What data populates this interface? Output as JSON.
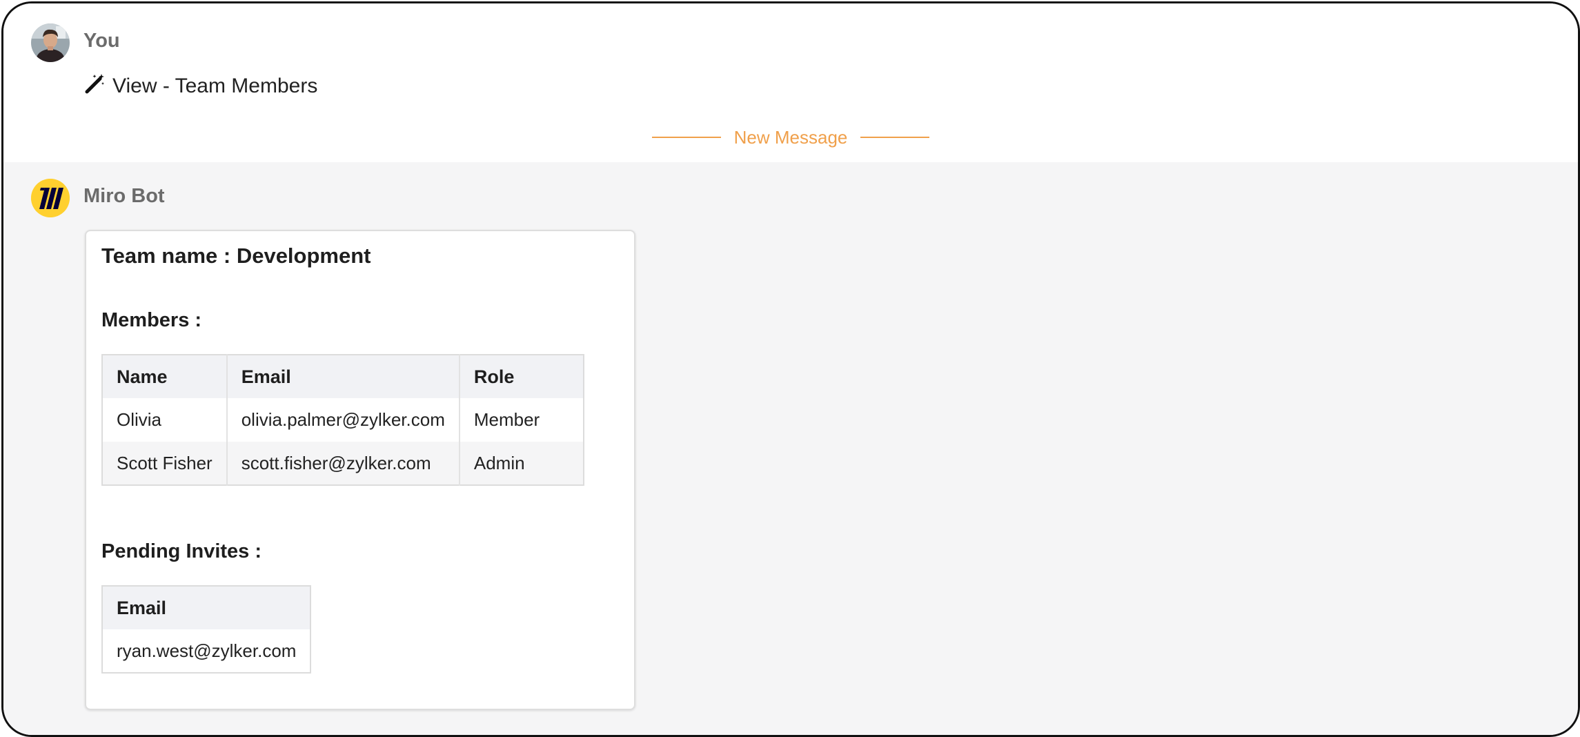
{
  "user_message": {
    "sender": "You",
    "command_icon": "magic-wand-icon",
    "command_text": "View - Team Members"
  },
  "divider": {
    "label": "New Message",
    "color": "#f0a04b"
  },
  "bot_message": {
    "sender": "Miro Bot",
    "avatar_icon": "miro-logo-icon",
    "avatar_color": "#ffd02f",
    "card": {
      "title": "Team name : Development",
      "members_heading": "Members :",
      "members_table": {
        "columns": [
          "Name",
          "Email",
          "Role"
        ],
        "rows": [
          [
            "Olivia",
            "olivia.palmer@zylker.com",
            "Member"
          ],
          [
            "Scott Fisher",
            "scott.fisher@zylker.com",
            "Admin"
          ]
        ]
      },
      "pending_heading": "Pending Invites :",
      "pending_table": {
        "columns": [
          "Email"
        ],
        "rows": [
          [
            "ryan.west@zylker.com"
          ]
        ]
      }
    }
  }
}
